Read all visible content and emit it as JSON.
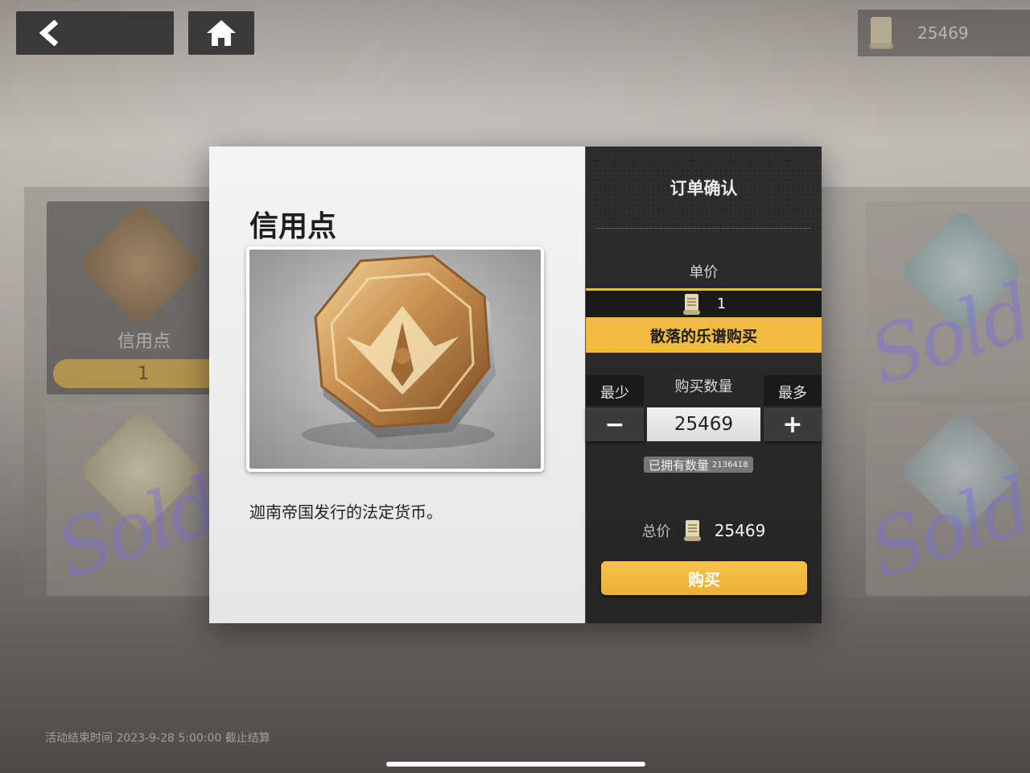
{
  "topbar": {
    "back_icon": "chevron-left-icon",
    "home_icon": "home-icon",
    "currency_icon": "score-sheet-icon",
    "currency_value": "25469"
  },
  "background": {
    "card_label": "信用点",
    "card_price": "1",
    "sold_text": "Sold",
    "footer_note": "活动结束时间 2023-9-28 5:00:00 截止结算"
  },
  "item": {
    "name": "信用点",
    "description": "迦南帝国发行的法定货币。",
    "image_icon": "credit-coin-icon"
  },
  "order": {
    "title": "订单确认",
    "unit_price_label": "单价",
    "unit_price": "1",
    "currency_icon": "score-sheet-icon",
    "buy_with_label": "散落的乐谱购买",
    "quantity_label": "购买数量",
    "min_label": "最少",
    "max_label": "最多",
    "minus_label": "−",
    "plus_label": "+",
    "quantity_value": "25469",
    "owned_label": "已拥有数量",
    "owned_count": "2136418",
    "total_label": "总价",
    "total_value": "25469",
    "buy_label": "购买"
  },
  "colors": {
    "accent": "#f2ba3e",
    "panel_dark": "#2c2c2c",
    "panel_light": "#f0f0f0"
  }
}
